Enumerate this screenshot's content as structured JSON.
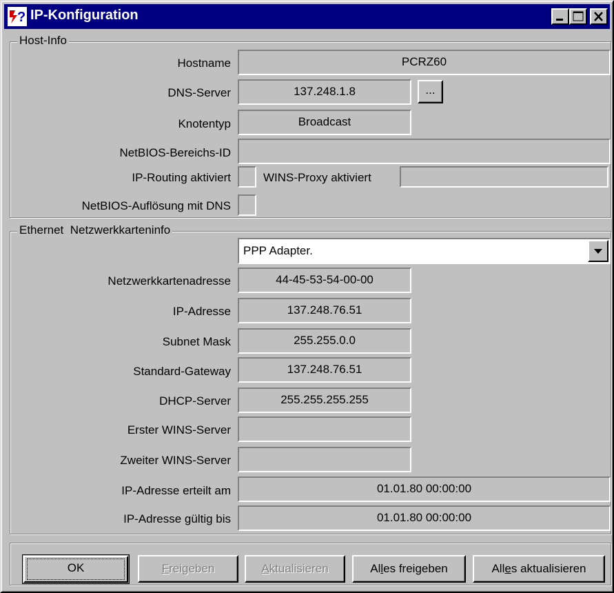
{
  "window": {
    "title": "IP-Konfiguration"
  },
  "host_info": {
    "legend": "Host-Info",
    "hostname_label": "Hostname",
    "hostname_value": "PCRZ60",
    "dns_label": "DNS-Server",
    "dns_value": "137.248.1.8",
    "dns_more_label": "...",
    "node_type_label": "Knotentyp",
    "node_type_value": "Broadcast",
    "netbios_scope_label": "NetBIOS-Bereichs-ID",
    "netbios_scope_value": "",
    "ip_routing_label": "IP-Routing aktiviert",
    "wins_proxy_label": "WINS-Proxy aktiviert",
    "wins_proxy_value": "",
    "netbios_dns_label": "NetBIOS-Auflösung mit DNS"
  },
  "adapter_info": {
    "legend": "Ethernet  Netzwerkkarteninfo",
    "selected_adapter": "PPP Adapter.",
    "rows": [
      {
        "label": "Netzwerkkartenadresse",
        "value": "44-45-53-54-00-00"
      },
      {
        "label": "IP-Adresse",
        "value": "137.248.76.51"
      },
      {
        "label": "Subnet Mask",
        "value": "255.255.0.0"
      },
      {
        "label": "Standard-Gateway",
        "value": "137.248.76.51"
      },
      {
        "label": "DHCP-Server",
        "value": "255.255.255.255"
      },
      {
        "label": "Erster WINS-Server",
        "value": ""
      },
      {
        "label": "Zweiter WINS-Server",
        "value": ""
      },
      {
        "label": "IP-Adresse erteilt am",
        "value": "01.01.80 00:00:00"
      },
      {
        "label": "IP-Adresse gültig bis",
        "value": "01.01.80 00:00:00"
      }
    ]
  },
  "buttons": {
    "ok": "OK",
    "release_a": "F",
    "release_b": "reigeben",
    "renew_a": "A",
    "renew_b": "ktualisieren",
    "release_all_a": "Al",
    "release_all_u": "l",
    "release_all_b": "es freigeben",
    "renew_all_a": "All",
    "renew_all_u": "e",
    "renew_all_b": "s aktualisieren"
  },
  "colors": {
    "face": "#c0c0c0",
    "titlebar": "#000080",
    "disabled_text": "#808080"
  }
}
